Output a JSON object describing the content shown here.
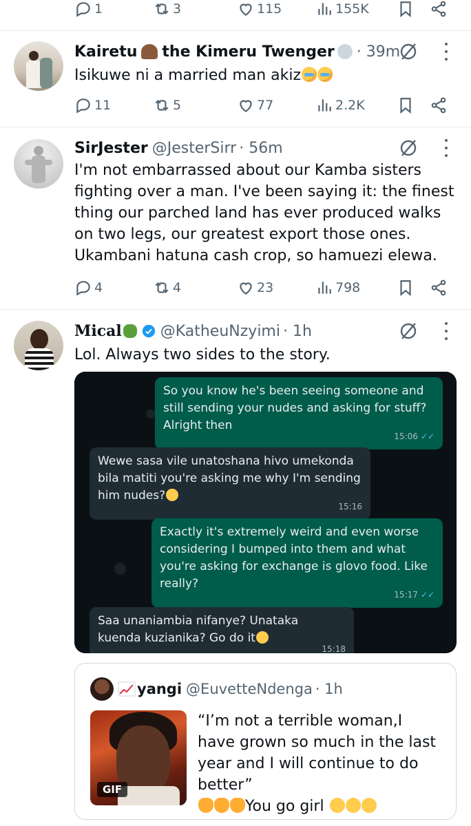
{
  "top_actions": {
    "replies": "1",
    "reposts": "3",
    "likes": "115",
    "views": "155K"
  },
  "tweets": [
    {
      "name": "Kairetu",
      "name_rest": "the Kimeru Twenger",
      "handle": "",
      "time": "· 39m",
      "text": "Isikuwe ni a married man akiz",
      "actions": {
        "replies": "11",
        "reposts": "5",
        "likes": "77",
        "views": "2.2K"
      }
    },
    {
      "name": "SirJester",
      "handle": "@JesterSirr",
      "time": "· 56m",
      "text": "I'm not embarrassed about our Kamba sisters fighting over a man. I've been saying it: the finest thing our parched land has ever produced walks on two legs, our greatest export those ones. Ukambani hatuna cash crop, so hamuezi elewa.",
      "actions": {
        "replies": "4",
        "reposts": "4",
        "likes": "23",
        "views": "798"
      }
    },
    {
      "name": "Mical",
      "handle": "@KatheuNzyimi",
      "time": "· 1h",
      "text": "Lol. Always two sides to the story."
    }
  ],
  "chat": {
    "messages": [
      {
        "dir": "out",
        "text": "So you know he's been seeing someone and still sending your nudes and asking for stuff? Alright then",
        "time": "15:06"
      },
      {
        "dir": "in",
        "text": "Wewe sasa vile unatoshana hivo umekonda bila matiti you're asking me why I'm sending him nudes?",
        "time": "15:16"
      },
      {
        "dir": "out",
        "text": "Exactly it's extremely weird and even worse considering I bumped into them and what you're asking for exchange is glovo food. Like really?",
        "time": "15:17"
      },
      {
        "dir": "in",
        "text": "Saa unaniambia nifanye? Unataka kuenda kuzianika? Go do it",
        "time": "15:18"
      }
    ]
  },
  "quote": {
    "name": "yangi",
    "handle": "@EuvetteNdenga",
    "time": "· 1h",
    "text": "“I’m not a terrible woman,I have grown so much in the last year and I will continue to do better”",
    "text2": "You go girl",
    "gif_label": "GIF"
  },
  "colors": {
    "verified": "#1d9bf0",
    "muted": "#536471",
    "chat_out": "#005c4b",
    "chat_in": "#202c33"
  }
}
